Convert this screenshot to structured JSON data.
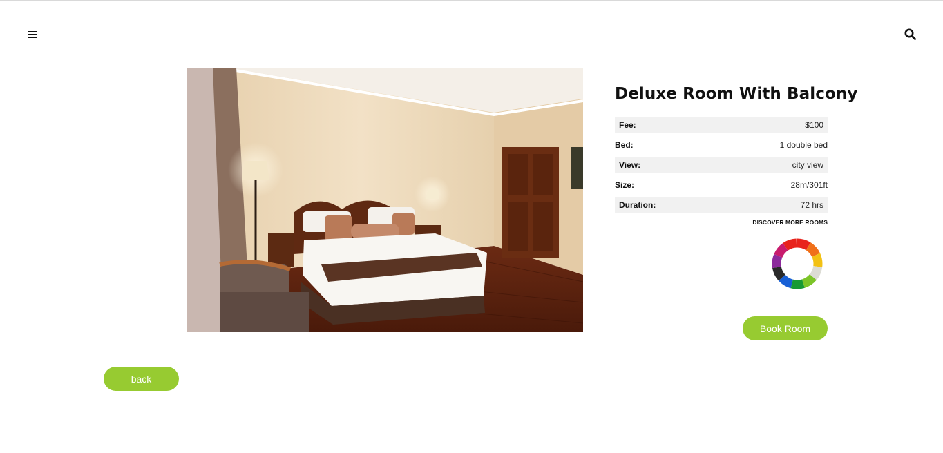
{
  "header": {
    "menu_icon": "hamburger-menu-icon",
    "search_icon": "search-icon"
  },
  "room": {
    "title": "Deluxe Room With Balcony",
    "photo_description_icon": "room-photo",
    "specs": [
      {
        "label": "Fee:",
        "value": "$100"
      },
      {
        "label": "Bed:",
        "value": "1 double bed"
      },
      {
        "label": "View:",
        "value": "city view"
      },
      {
        "label": "Size:",
        "value": "28m/301ft"
      },
      {
        "label": "Duration:",
        "value": "72 hrs"
      }
    ],
    "discover_label": "DISCOVER MORE ROOMS",
    "book_label": "Book Room"
  },
  "footer": {
    "back_label": "back"
  },
  "colors": {
    "accent": "#97cb31",
    "row_shade": "#f1f1f1"
  }
}
